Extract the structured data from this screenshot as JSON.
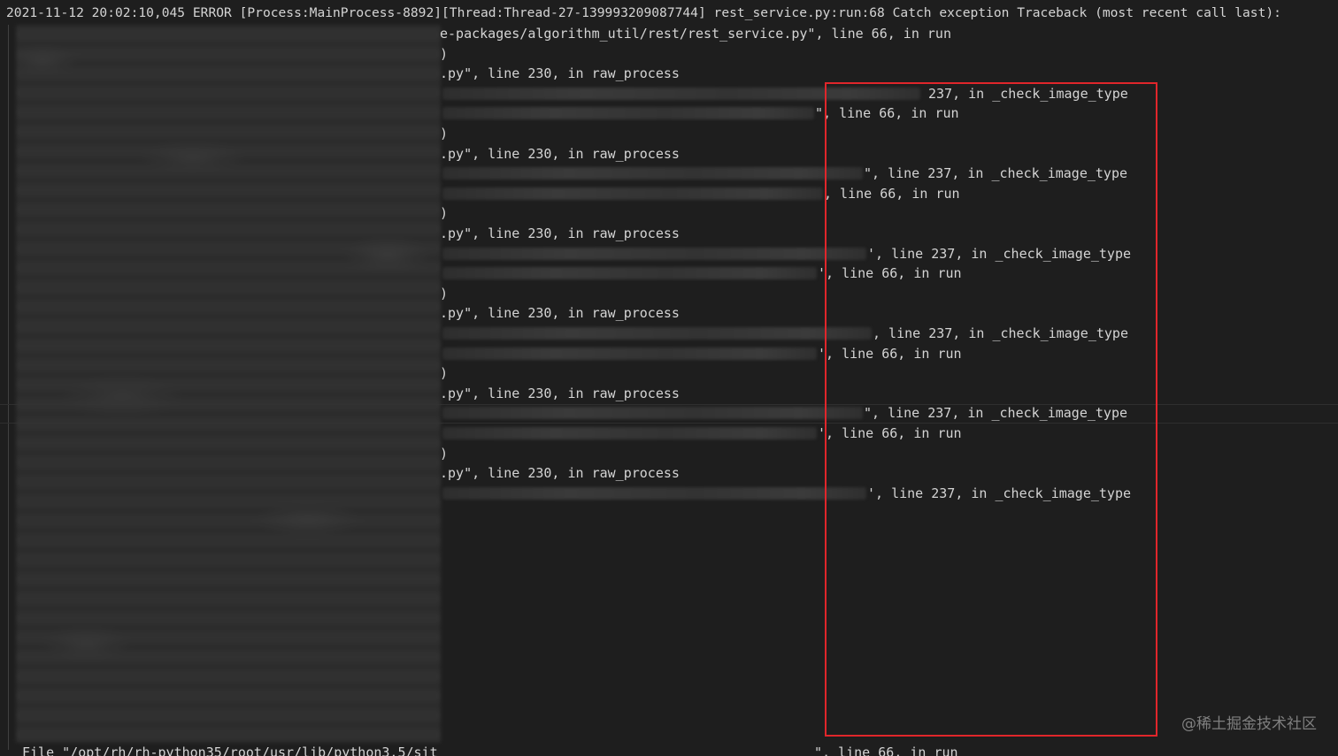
{
  "header_line": "2021-11-12 20:02:10,045 ERROR [Process:MainProcess-8892][Thread:Thread-27-139993209087744] rest_service.py:run:68 Catch exception Traceback (most recent call last):",
  "lines": [
    {
      "mid": "e-packages/algorithm_util/rest/rest_service.py\", line 66, in run",
      "right": ""
    },
    {
      "mid": ")",
      "right": ""
    },
    {
      "mid": ".py\", line 230, in raw_process",
      "right": ""
    },
    {
      "mid": "",
      "right": "237, in _check_image_type"
    },
    {
      "mid": "",
      "right": "\", line 66, in run"
    },
    {
      "mid": ")",
      "right": ""
    },
    {
      "mid": ".py\", line 230, in raw_process",
      "right": ""
    },
    {
      "mid": "",
      "right": "\", line 237, in _check_image_type"
    },
    {
      "mid": "",
      "right": ", line 66, in run"
    },
    {
      "mid": ")",
      "right": ""
    },
    {
      "mid": ".py\", line 230, in raw_process",
      "right": ""
    },
    {
      "mid": "",
      "right": "', line 237, in _check_image_type"
    },
    {
      "mid": "",
      "right": "', line 66, in run"
    },
    {
      "mid": ")",
      "right": ""
    },
    {
      "mid": ".py\", line 230, in raw_process",
      "right": ""
    },
    {
      "mid": "",
      "right": ", line 237, in _check_image_type"
    },
    {
      "mid": "",
      "right": "', line 66, in run"
    },
    {
      "mid": ")",
      "right": ""
    },
    {
      "mid": ".py\", line 230, in raw_process",
      "right": ""
    },
    {
      "mid": "",
      "right": "\", line 237, in _check_image_type"
    },
    {
      "mid": "",
      "right": "', line 66, in run"
    },
    {
      "mid": ")",
      "right": ""
    },
    {
      "mid": ".py\", line 230, in raw_process",
      "right": ""
    },
    {
      "mid": "",
      "right": "', line 237, in _check_image_type"
    }
  ],
  "footer_line_left": "File \"/opt/rh/rh-python35/root/usr/lib/python3.5/sit",
  "footer_line_right": "\", line 66, in run",
  "watermark": "@稀土掘金技术社区",
  "colors": {
    "background": "#1e1e1e",
    "text": "#d4d4d4",
    "highlight_box": "#e0262b"
  }
}
